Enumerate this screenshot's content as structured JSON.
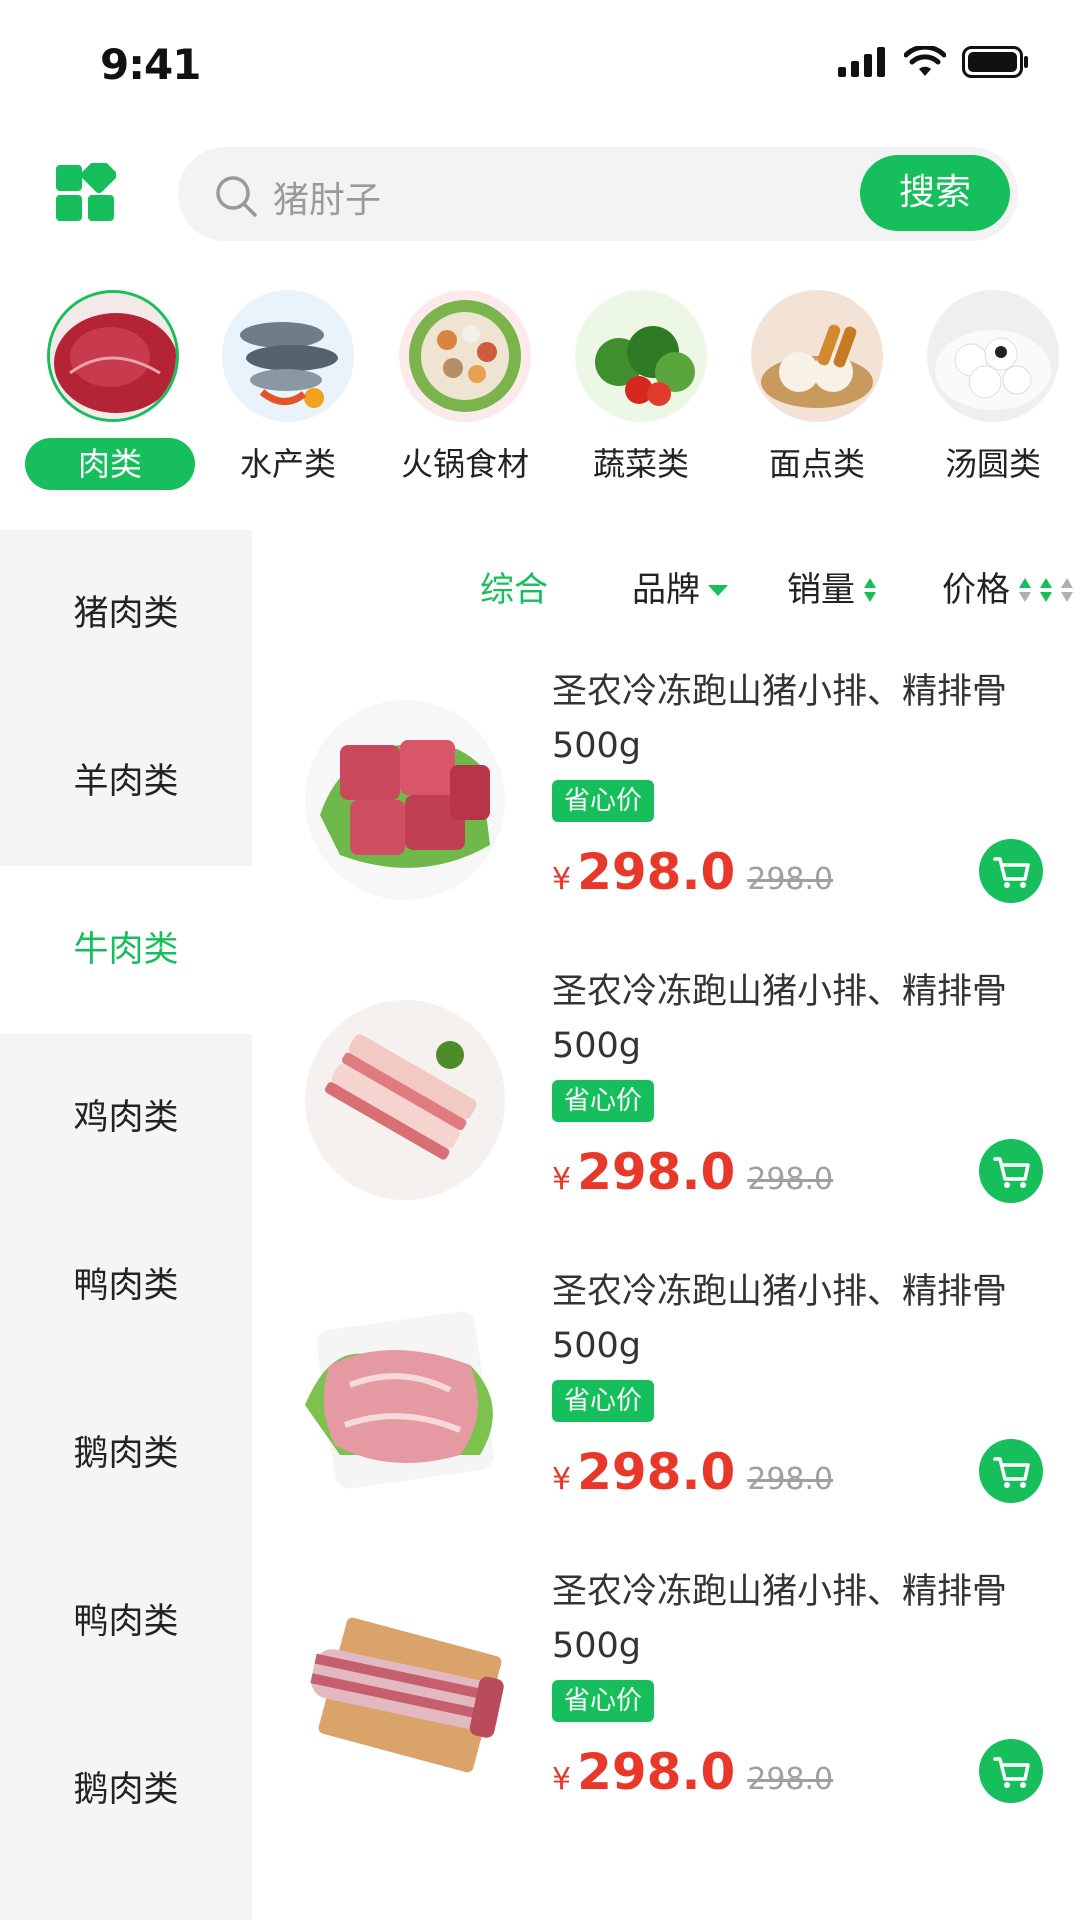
{
  "status_bar": {
    "time": "9:41"
  },
  "search": {
    "placeholder": "猪肘子",
    "button_label": "搜索"
  },
  "categories": [
    {
      "label": "肉类",
      "active": true
    },
    {
      "label": "水产类"
    },
    {
      "label": "火锅食材"
    },
    {
      "label": "蔬菜类"
    },
    {
      "label": "面点类"
    },
    {
      "label": "汤圆类"
    }
  ],
  "sidebar": {
    "items": [
      {
        "label": "猪肉类"
      },
      {
        "label": "羊肉类"
      },
      {
        "label": "牛肉类",
        "active": true
      },
      {
        "label": "鸡肉类"
      },
      {
        "label": "鸭肉类"
      },
      {
        "label": "鹅肉类"
      },
      {
        "label": "鸭肉类"
      },
      {
        "label": "鹅肉类"
      }
    ]
  },
  "filters": {
    "comprehensive": "综合",
    "brand": "品牌",
    "sales": "销量",
    "price": "价格"
  },
  "products": [
    {
      "title": "圣农冷冻跑山猪小排、精排骨500g",
      "tag": "省心价",
      "currency": "¥",
      "price": "298.0",
      "original_price": "298.0"
    },
    {
      "title": "圣农冷冻跑山猪小排、精排骨500g",
      "tag": "省心价",
      "currency": "¥",
      "price": "298.0",
      "original_price": "298.0"
    },
    {
      "title": "圣农冷冻跑山猪小排、精排骨500g",
      "tag": "省心价",
      "currency": "¥",
      "price": "298.0",
      "original_price": "298.0"
    },
    {
      "title": "圣农冷冻跑山猪小排、精排骨500g",
      "tag": "省心价",
      "currency": "¥",
      "price": "298.0",
      "original_price": "298.0"
    }
  ],
  "colors": {
    "accent": "#17bf5c",
    "price": "#e8382a",
    "sidebar_bg": "#f5f5f5"
  },
  "icons": [
    "signal-icon",
    "wifi-icon",
    "battery-icon",
    "grid-menu-icon",
    "search-icon",
    "cart-icon",
    "triangle-down-icon",
    "sort-icon"
  ]
}
